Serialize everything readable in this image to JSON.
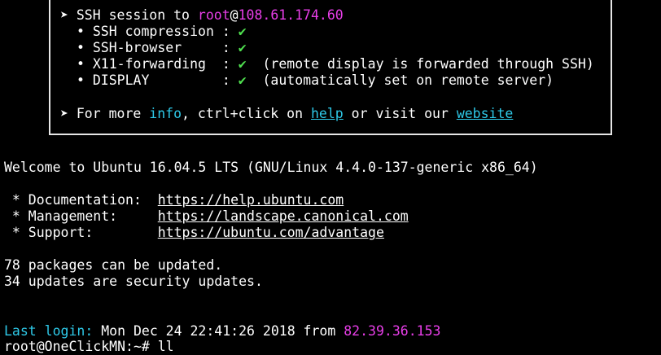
{
  "banner": {
    "bullet_arrow": "➤",
    "session_prefix": "SSH session to ",
    "session_user": "root",
    "session_at": "@",
    "session_host": "108.61.174.60",
    "items": [
      {
        "bullet": "•",
        "label": "SSH compression : ",
        "check": "✔",
        "note": ""
      },
      {
        "bullet": "•",
        "label": "SSH-browser     : ",
        "check": "✔",
        "note": ""
      },
      {
        "bullet": "•",
        "label": "X11-forwarding  : ",
        "check": "✔",
        "note": "  (remote display is forwarded through SSH)"
      },
      {
        "bullet": "•",
        "label": "DISPLAY         : ",
        "check": "✔",
        "note": "  (automatically set on remote server)"
      }
    ],
    "more_prefix": "For more ",
    "more_info": "info",
    "more_mid": ", ctrl+click on ",
    "more_help": "help",
    "more_or": " or visit our ",
    "more_website": "website",
    "colors": {
      "magenta": "#e83ee8",
      "cyan": "#2ec9e8",
      "green": "#4fe04f",
      "border": "#e6e6e6"
    }
  },
  "welcome": "Welcome to Ubuntu 16.04.5 LTS (GNU/Linux 4.4.0-137-generic x86_64)",
  "links": [
    {
      "label": " * Documentation:  ",
      "url": "https://help.ubuntu.com"
    },
    {
      "label": " * Management:     ",
      "url": "https://landscape.canonical.com"
    },
    {
      "label": " * Support:        ",
      "url": "https://ubuntu.com/advantage"
    }
  ],
  "updates": {
    "packages": "78 packages can be updated.",
    "security": "34 updates are security updates."
  },
  "last_login": {
    "label": "Last login:",
    "date": " Mon Dec 24 22:41:26 2018 from ",
    "ip": "82.39.36.153"
  },
  "prompt": {
    "text": "root@OneClickMN:~# ",
    "command": "ll"
  }
}
